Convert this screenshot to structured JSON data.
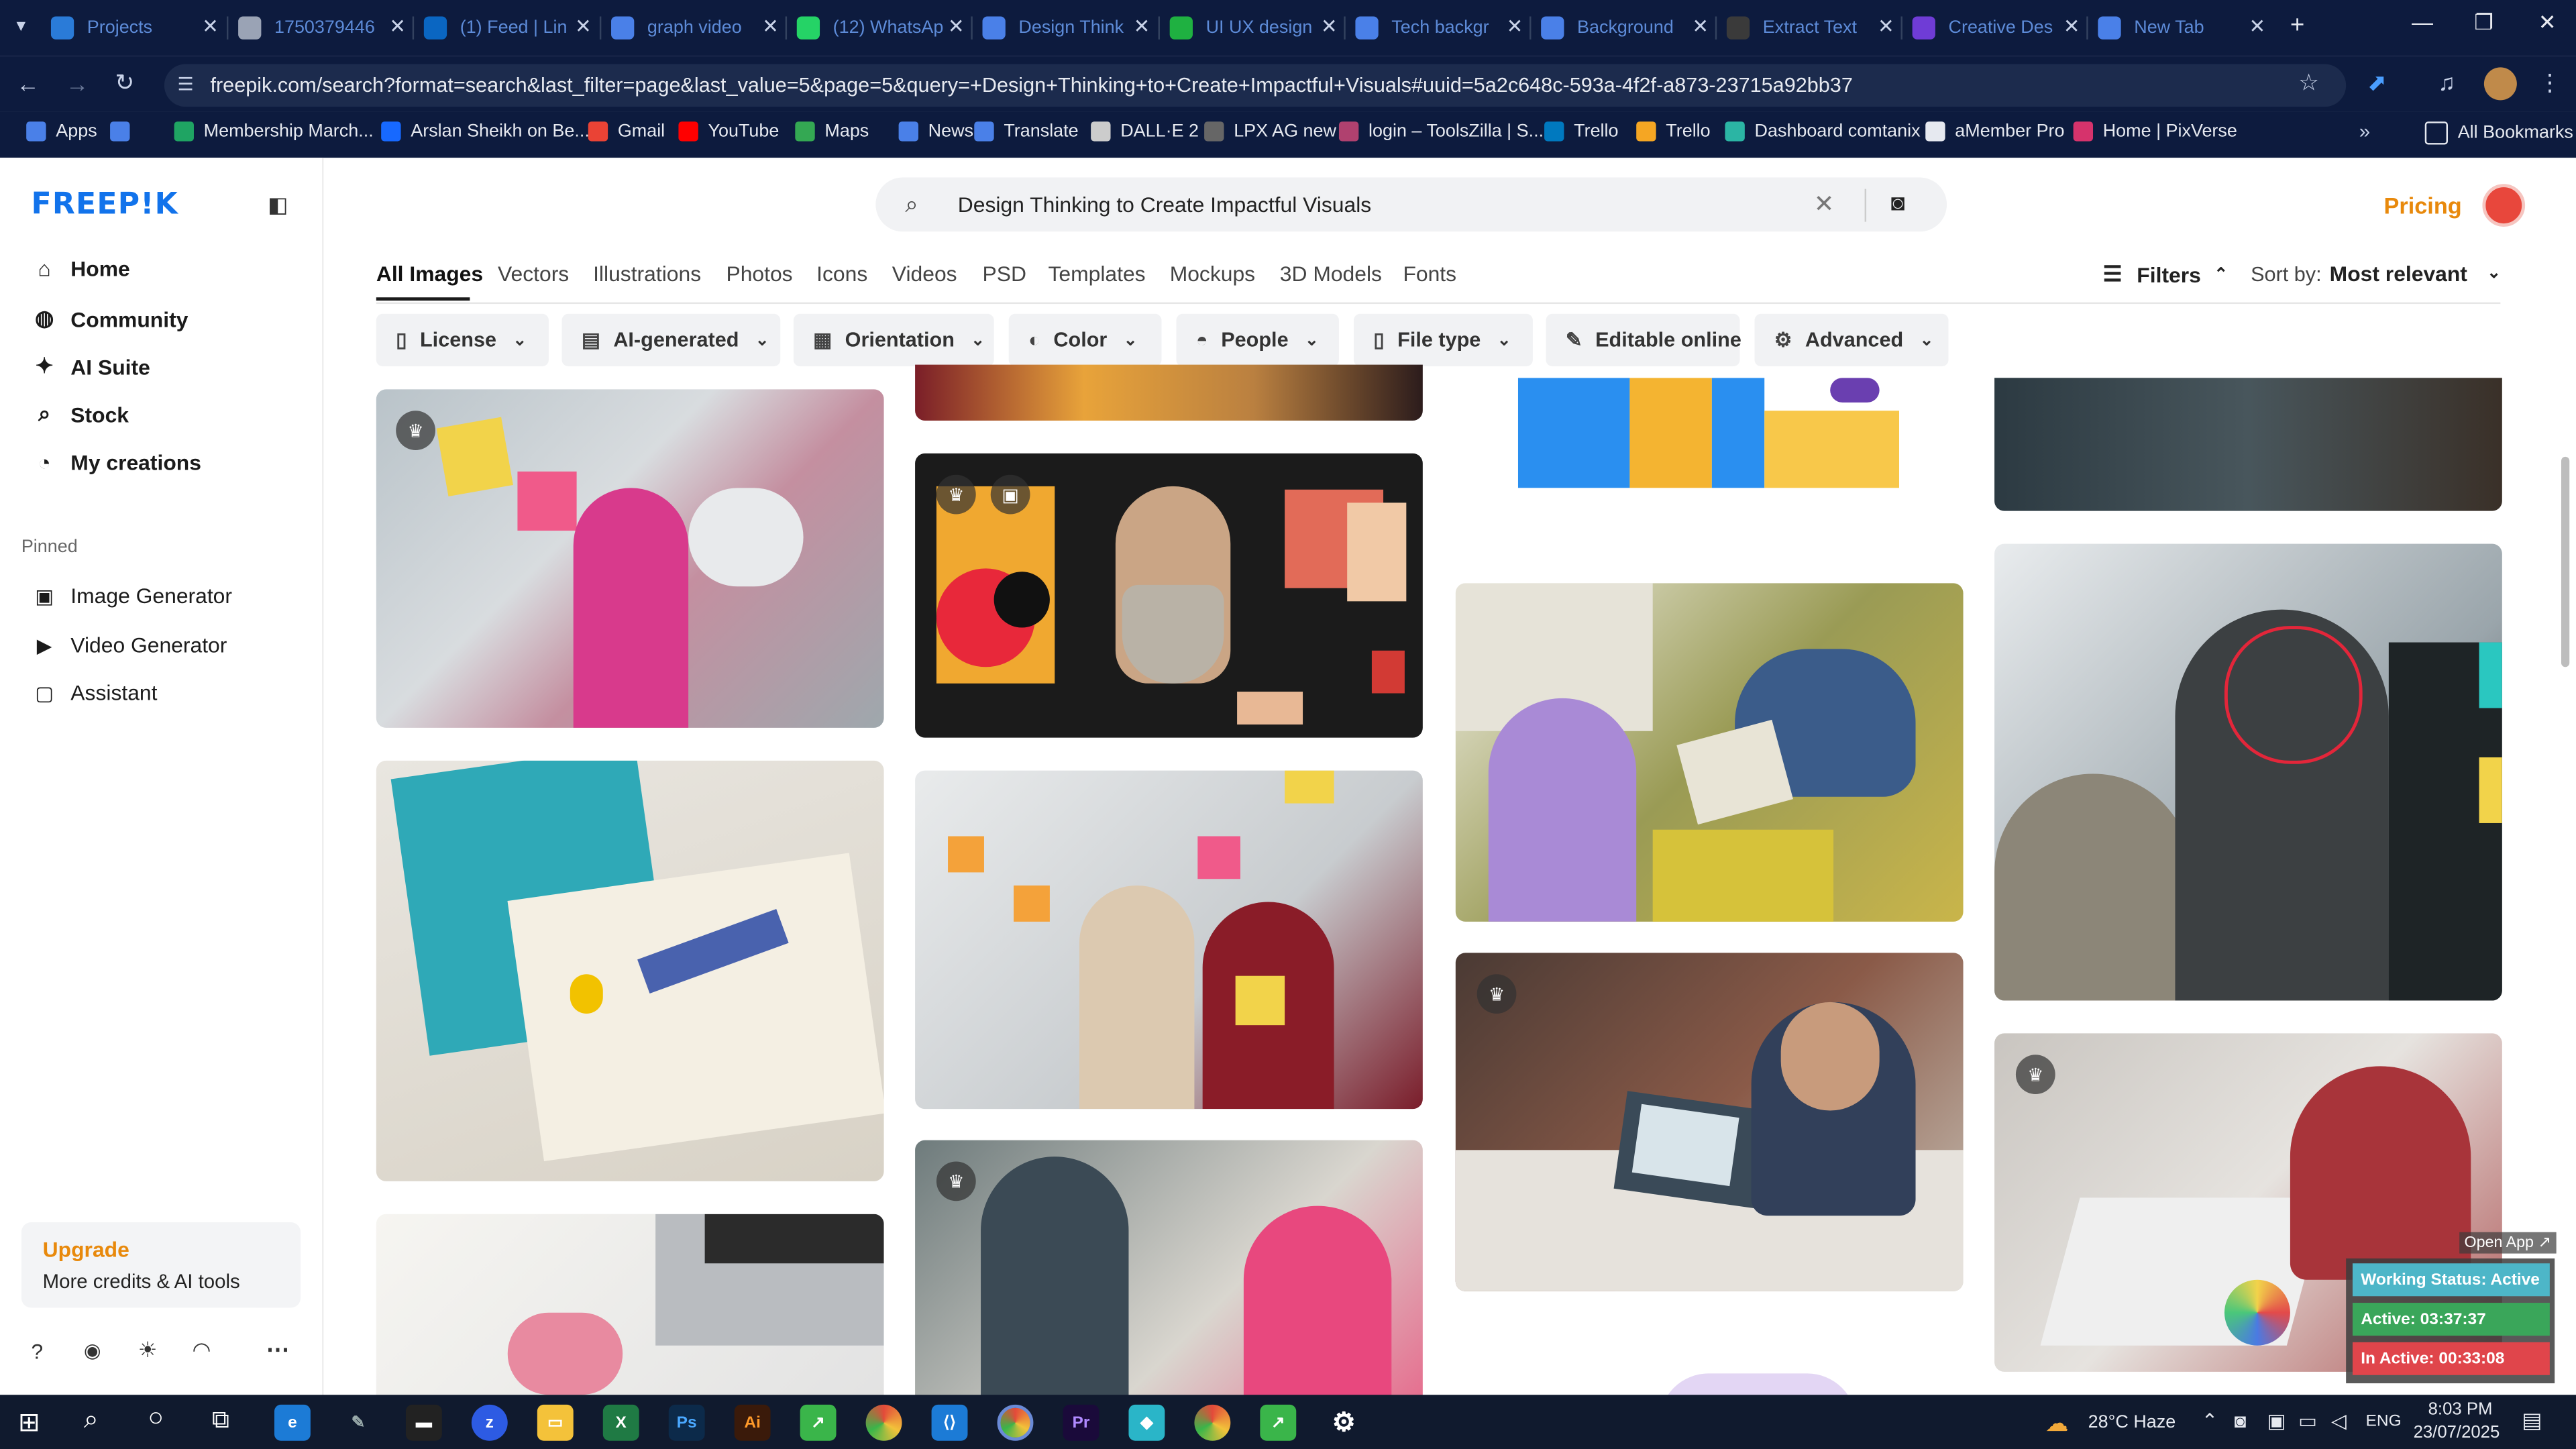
{
  "browser": {
    "tabs": [
      {
        "title": "Projects",
        "color": "#2a7bd8"
      },
      {
        "title": "1750379446",
        "color": "#9aa3b5"
      },
      {
        "title": "(1) Feed | Lin",
        "color": "#0a66c2"
      },
      {
        "title": "graph video",
        "color": "#4a80e8"
      },
      {
        "title": "(12) WhatsAp",
        "color": "#25d366"
      },
      {
        "title": "Design Think",
        "color": "#4a80e8"
      },
      {
        "title": "UI UX design",
        "color": "#1fb141"
      },
      {
        "title": "Tech backgr",
        "color": "#4a80e8"
      },
      {
        "title": "Background",
        "color": "#4a80e8"
      },
      {
        "title": "Extract Text",
        "color": "#3a3a3a"
      },
      {
        "title": "Creative Des",
        "color": "#6f3cd6"
      },
      {
        "title": "New Tab",
        "color": "#4a80e8"
      }
    ],
    "url": "freepik.com/search?format=search&last_filter=page&last_value=5&page=5&query=+Design+Thinking+to+Create+Impactful+Visuals#uuid=5a2c648c-593a-4f2f-a873-23715a92bb37",
    "bookmarks": [
      {
        "label": "Apps",
        "color": "#4a80e8"
      },
      {
        "label": "",
        "color": "#4a80e8"
      },
      {
        "label": "Membership March...",
        "color": "#1fa463"
      },
      {
        "label": "Arslan Sheikh on Be...",
        "color": "#1769ff"
      },
      {
        "label": "Gmail",
        "color": "#ea4335"
      },
      {
        "label": "YouTube",
        "color": "#ff0000"
      },
      {
        "label": "Maps",
        "color": "#34a853"
      },
      {
        "label": "News",
        "color": "#4a80e8"
      },
      {
        "label": "Translate",
        "color": "#4a80e8"
      },
      {
        "label": "DALL·E 2",
        "color": "#cccccc"
      },
      {
        "label": "LPX AG new",
        "color": "#666666"
      },
      {
        "label": "login – ToolsZilla | S...",
        "color": "#b0416f"
      },
      {
        "label": "Trello",
        "color": "#0079bf"
      },
      {
        "label": "Trello",
        "color": "#f5a623"
      },
      {
        "label": "Dashboard comtanix",
        "color": "#2bb5a4"
      },
      {
        "label": "aMember Pro",
        "color": "#e6e9f0"
      },
      {
        "label": "Home | PixVerse",
        "color": "#d6336c"
      }
    ],
    "all_bookmarks": "All Bookmarks"
  },
  "sidebar": {
    "logo": "FREEP!K",
    "nav": [
      {
        "label": "Home",
        "icon": "home-icon",
        "glyph": "⌂"
      },
      {
        "label": "Community",
        "icon": "globe-icon",
        "glyph": "◍"
      },
      {
        "label": "AI Suite",
        "icon": "sparkle-icon",
        "glyph": "✦"
      },
      {
        "label": "Stock",
        "icon": "search-icon",
        "glyph": "⌕"
      },
      {
        "label": "My creations",
        "icon": "user-icon",
        "glyph": "◔"
      }
    ],
    "pinned_heading": "Pinned",
    "pinned": [
      {
        "label": "Image Generator",
        "glyph": "▣"
      },
      {
        "label": "Video Generator",
        "glyph": "▶"
      },
      {
        "label": "Assistant",
        "glyph": "▢"
      }
    ],
    "upgrade": {
      "title": "Upgrade",
      "subtitle": "More credits & AI tools",
      "color": "#e8890c"
    }
  },
  "header": {
    "search_query": "Design Thinking to Create Impactful Visuals",
    "pricing": "Pricing",
    "pricing_color": "#e8890c"
  },
  "categories": [
    "All Images",
    "Vectors",
    "Illustrations",
    "Photos",
    "Icons",
    "Videos",
    "PSD",
    "Templates",
    "Mockups",
    "3D Models",
    "Fonts"
  ],
  "filters_label": "Filters",
  "sort": {
    "label": "Sort by:",
    "value": "Most relevant"
  },
  "filter_buttons": [
    {
      "label": "License",
      "glyph": "▯",
      "dropdown": true
    },
    {
      "label": "AI-generated",
      "glyph": "▤",
      "dropdown": true
    },
    {
      "label": "Orientation",
      "glyph": "▦",
      "dropdown": true
    },
    {
      "label": "Color",
      "glyph": "◐",
      "dropdown": true
    },
    {
      "label": "People",
      "glyph": "◓",
      "dropdown": true
    },
    {
      "label": "File type",
      "glyph": "▯",
      "dropdown": true
    },
    {
      "label": "Editable online",
      "glyph": "✎",
      "dropdown": false
    },
    {
      "label": "Advanced",
      "glyph": "⚙",
      "dropdown": true
    }
  ],
  "tracker": {
    "open": "Open App ↗",
    "status": "Working Status: Active",
    "active": "Active: 03:37:37",
    "inactive": "In Active: 00:33:08"
  },
  "taskbar": {
    "weather": "28°C Haze",
    "lang": "ENG",
    "time": "8:03 PM",
    "date": "23/07/2025"
  }
}
